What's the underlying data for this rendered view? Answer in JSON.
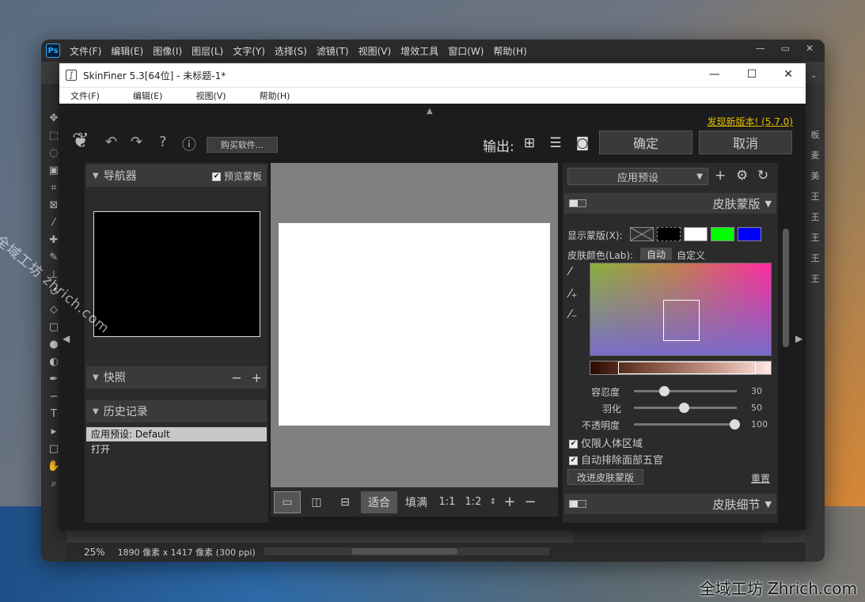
{
  "photoshop": {
    "logo": "Ps",
    "menu": [
      "文件(F)",
      "编辑(E)",
      "图像(I)",
      "图层(L)",
      "文字(Y)",
      "选择(S)",
      "滤镜(T)",
      "视图(V)",
      "增效工具",
      "窗口(W)",
      "帮助(H)"
    ],
    "status": {
      "zoom": "25%",
      "dimensions": "1890 像素 x 1417 像素 (300 ppi)"
    },
    "right_panel_glyphs": [
      "板",
      "麦",
      "美",
      "王",
      "王",
      "王",
      "王",
      "王"
    ]
  },
  "skinfiner": {
    "title": "SkinFiner 5.3[64位] - 未标题-1*",
    "menu": [
      "文件(F)",
      "编辑(E)",
      "视图(V)",
      "帮助(H)"
    ],
    "toolbar": {
      "buy_label": "购买软件...",
      "new_version": "发现新版本! (5.7.0)",
      "output_label": "输出:",
      "ok_label": "确定",
      "cancel_label": "取消"
    },
    "navigator": {
      "title": "导航器",
      "preview_mask_label": "预览蒙板",
      "preview_mask_checked": true
    },
    "snapshots": {
      "title": "快照"
    },
    "history": {
      "title": "历史记录",
      "items": [
        "应用预设: Default",
        "打开"
      ]
    },
    "bottom_bar": {
      "fit": "适合",
      "fill": "填满",
      "one_to_one": "1:1",
      "one_to_two": "1:2"
    },
    "right_panel": {
      "preset_label": "应用预设",
      "skin_mask": {
        "title": "皮肤蒙版",
        "show_mask_label": "显示蒙版(X):",
        "skin_color_label": "皮肤颜色(Lab):",
        "auto_label": "自动",
        "custom_label": "自定义",
        "swatch_colors": [
          "#000000",
          "#ffffff",
          "#00ff00",
          "#0000ff"
        ],
        "sliders": [
          {
            "label": "容忍度",
            "value": 30
          },
          {
            "label": "羽化",
            "value": 50
          },
          {
            "label": "不透明度",
            "value": 100
          }
        ],
        "checkboxes": [
          {
            "label": "仅限人体区域",
            "checked": true
          },
          {
            "label": "自动排除面部五官",
            "checked": true
          }
        ],
        "improve_label": "改进皮肤蒙版",
        "reset_label": "重置"
      },
      "skin_detail": {
        "title": "皮肤细节"
      }
    }
  },
  "watermark": {
    "diagonal": "全域工坊 zhrich.com",
    "bottom": "全域工坊 Zhrich.com"
  }
}
